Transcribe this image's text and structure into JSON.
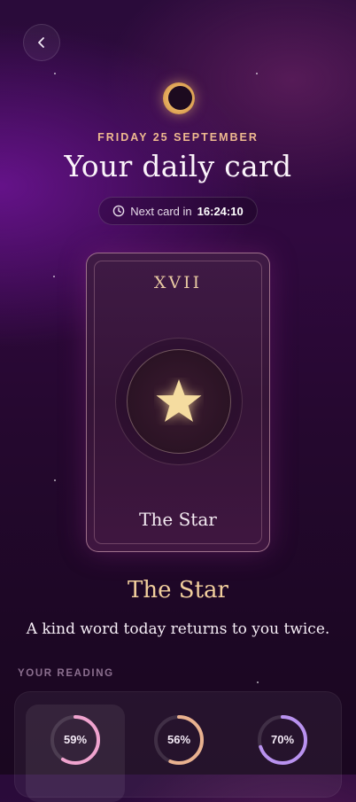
{
  "header": {
    "back_icon": "chevron-left-icon"
  },
  "hero": {
    "moon_icon": "eclipse-moon-icon",
    "date": "FRIDAY 25 SEPTEMBER",
    "title": "Your daily card",
    "timer_prefix": "Next card in",
    "timer_value": "16:24:10"
  },
  "card": {
    "numeral": "XVII",
    "symbol_icon": "star-icon",
    "name": "The Star"
  },
  "result": {
    "title": "The Star",
    "message": "A kind word today returns to you twice."
  },
  "reading": {
    "label": "YOUR READING",
    "gauges": [
      {
        "value": 59,
        "text": "59%",
        "color": "#f0a3cf",
        "active": true
      },
      {
        "value": 56,
        "text": "56%",
        "color": "#e9b18f",
        "active": false
      },
      {
        "value": 70,
        "text": "70%",
        "color": "#b992f0",
        "active": false
      }
    ]
  }
}
